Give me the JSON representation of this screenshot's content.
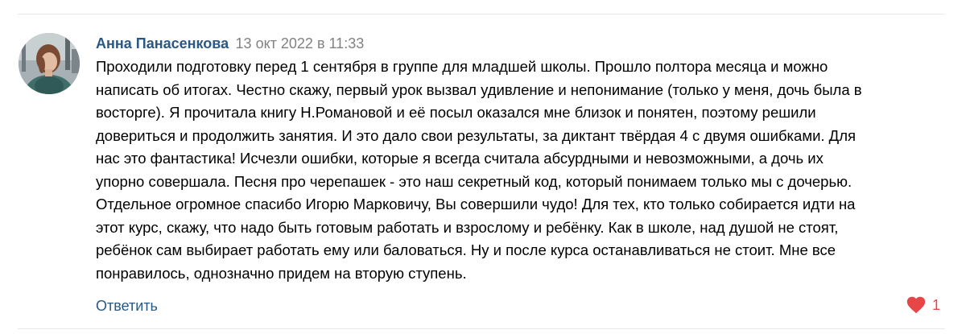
{
  "comment": {
    "author": "Анна Панасенкова",
    "date": "13 окт 2022 в 11:33",
    "text": "Проходили подготовку перед 1 сентября в группе для младшей школы. Прошло полтора месяца и можно\nнаписать об итогах. Честно скажу, первый урок вызвал удивление и непонимание (только у меня, дочь была в\nвосторге). Я прочитала книгу Н.Романовой и её посыл оказался мне близок и понятен, поэтому решили\nдовериться и продолжить занятия. И это дало свои результаты, за диктант твёрдая 4 с двумя ошибками. Для\nнас это фантастика! Исчезли ошибки, которые я всегда считала абсурдными и невозможными, а дочь их\nупорно совершала. Песня про черепашек - это наш секретный код, который понимаем только мы с дочерью.\nОтдельное огромное спасибо Игорю Марковичу, Вы совершили чудо! Для тех, кто только собирается идти на\nэтот курс, скажу, что надо быть готовым работать и взрослому и ребёнку. Как в школе, над душой не стоят,\nребёнок сам выбирает работать ему или баловаться. Ну и после курса останавливаться не стоит. Мне все\nпонравилось, однозначно придем на вторую ступень.",
    "reply_label": "Ответить",
    "likes": "1",
    "liked": true
  },
  "icons": {
    "avatar": "avatar-photo",
    "like": "heart-icon"
  },
  "colors": {
    "link": "#2a5885",
    "meta": "#828282",
    "like": "#e64646",
    "divider": "#e7e8ec"
  }
}
